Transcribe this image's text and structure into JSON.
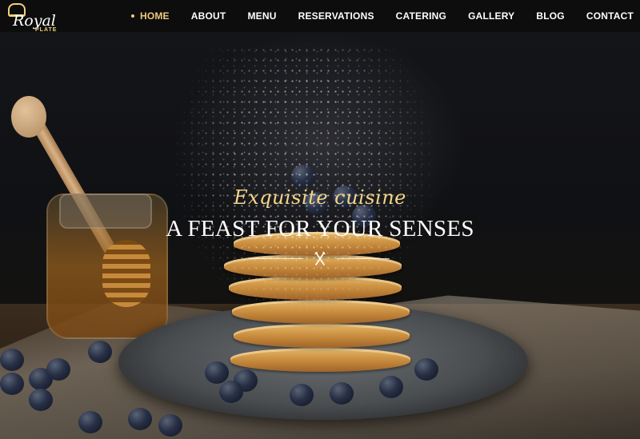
{
  "brand": {
    "name": "Royal",
    "sub": "PLATE",
    "accent_color": "#f0c97a"
  },
  "nav": {
    "items": [
      {
        "label": "HOME",
        "active": true
      },
      {
        "label": "ABOUT",
        "active": false
      },
      {
        "label": "MENU",
        "active": false
      },
      {
        "label": "RESERVATIONS",
        "active": false
      },
      {
        "label": "CATERING",
        "active": false
      },
      {
        "label": "GALLERY",
        "active": false
      },
      {
        "label": "BLOG",
        "active": false
      },
      {
        "label": "CONTACT",
        "active": false
      }
    ]
  },
  "hero": {
    "tagline": "Exquisite cuisine",
    "headline": "A FEAST FOR YOUR SENSES",
    "divider_icon": "fork-knife-icon"
  }
}
